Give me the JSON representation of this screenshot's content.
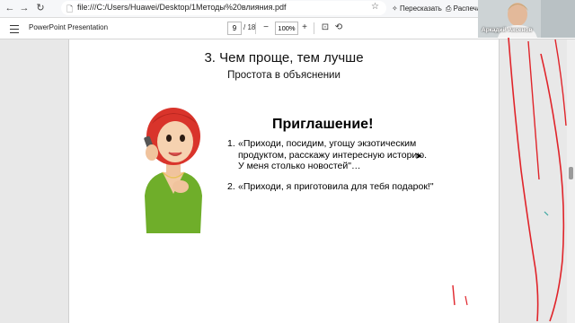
{
  "browser": {
    "url": "file:///C:/Users/Huawei/Desktop/1Методы%20влияния.pdf",
    "retell_label": "Пересказать",
    "print_label": "Распеча"
  },
  "pdf_toolbar": {
    "title": "PowerPoint Presentation",
    "current_page": "9",
    "total_pages": "/ 18",
    "zoom": "100%"
  },
  "slide": {
    "title": "3. Чем проще, тем лучше",
    "subtitle": "Простота в объяснении",
    "heading": "Приглашение!",
    "quotes": [
      {
        "number": "1.",
        "lines": [
          "«Приходи, посидим, угощу экзотическим",
          "продуктом, расскажу интересную историю.",
          "У меня столько новостей\"…"
        ]
      },
      {
        "number": "2.",
        "lines": [
          "«Приходи, я приготовила для тебя подарок!\""
        ]
      }
    ]
  },
  "webcam": {
    "name": "Аркадий Аксенов"
  },
  "colors": {
    "annotation_pen": "#e0242a",
    "hair": "#d9342b",
    "dress": "#6fae2a"
  }
}
